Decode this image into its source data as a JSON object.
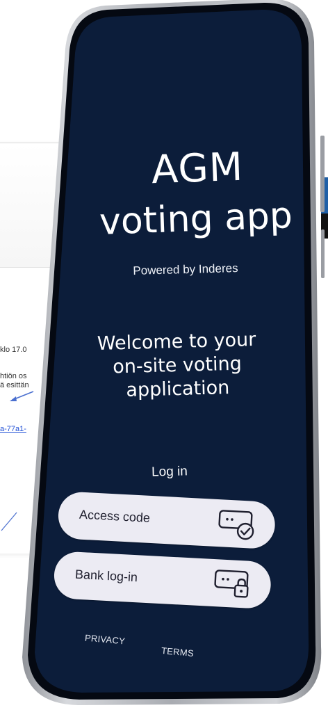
{
  "background": {
    "texts": [
      {
        "text": "klo 17.0",
        "kind": "text"
      },
      {
        "text": "htiön os",
        "kind": "text"
      },
      {
        "text": "ä esittän",
        "kind": "text"
      },
      {
        "text": "a-77a1-",
        "kind": "link"
      }
    ]
  },
  "app": {
    "title_line1": "AGM",
    "title_line2": "voting app",
    "powered_by": "Powered by Inderes",
    "welcome": "Welcome to your on-site voting application",
    "login_label": "Log in",
    "buttons": {
      "access_code": "Access code",
      "bank_login": "Bank log-in"
    },
    "footer": {
      "privacy": "PRIVACY",
      "terms": "TERMS"
    }
  },
  "colors": {
    "screen": "#0c1d3a",
    "pill": "#ecebf3",
    "text_on_dark": "#ffffff",
    "bezel": "#b9bcc2"
  },
  "icons": {
    "access_code": "code-check-icon",
    "bank_login": "code-lock-icon",
    "arrow": "arrow-icon"
  }
}
